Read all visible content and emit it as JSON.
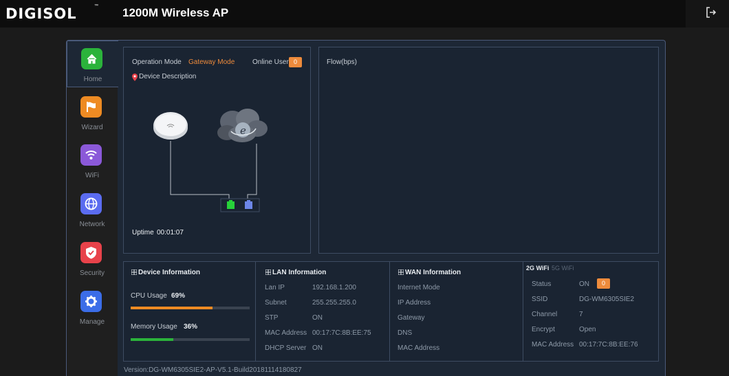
{
  "header": {
    "logo": "DIGISOL",
    "logo_tm": "™",
    "title": "1200M Wireless AP"
  },
  "sidebar": {
    "items": [
      {
        "label": "Home",
        "icon": "home-icon",
        "color": "#2bb33b",
        "active": true
      },
      {
        "label": "Wizard",
        "icon": "flag-icon",
        "color": "#ee8b23"
      },
      {
        "label": "WiFi",
        "icon": "wifi-icon",
        "color": "#8b59d9"
      },
      {
        "label": "Network",
        "icon": "globe-icon",
        "color": "#5b6cf0"
      },
      {
        "label": "Security",
        "icon": "shield-icon",
        "color": "#e8424a"
      },
      {
        "label": "Manage",
        "icon": "gear-icon",
        "color": "#3b6de8"
      }
    ]
  },
  "status": {
    "operation_mode_label": "Operation Mode",
    "operation_mode_value": "Gateway Mode",
    "online_user_label": "Online User",
    "online_user_count": "0",
    "device_description": "Device Description",
    "uptime_label": "Uptime",
    "uptime_value": "00:01:07"
  },
  "flow": {
    "label": "Flow(bps)"
  },
  "device_info": {
    "title": "Device Information",
    "cpu_label": "CPU Usage",
    "cpu_value": "69%",
    "cpu_fraction": 0.69,
    "memory_label": "Memory Usage",
    "memory_value": "36%",
    "memory_fraction": 0.36,
    "cpu_color": "#ee8b23",
    "memory_color": "#2bb33b"
  },
  "lan_info": {
    "title": "LAN Information",
    "rows": [
      {
        "label": "Lan IP",
        "value": "192.168.1.200"
      },
      {
        "label": "Subnet",
        "value": "255.255.255.0"
      },
      {
        "label": "STP",
        "value": "ON"
      },
      {
        "label": "MAC Address",
        "value": "00:17:7C:8B:EE:75"
      },
      {
        "label": "DHCP Server",
        "value": "ON"
      }
    ]
  },
  "wan_info": {
    "title": "WAN Information",
    "rows": [
      {
        "label": "Internet Mode"
      },
      {
        "label": "IP Address"
      },
      {
        "label": "Gateway"
      },
      {
        "label": "DNS"
      },
      {
        "label": "MAC Address"
      }
    ]
  },
  "wifi_info": {
    "tab_2g": "2G WiFi",
    "tab_5g": "5G WiFi",
    "status_label": "Status",
    "status_value": "ON",
    "status_count": "0",
    "ssid_label": "SSID",
    "ssid_value": "DG-WM6305SIE2",
    "channel_label": "Channel",
    "channel_value": "7",
    "encrypt_label": "Encrypt",
    "encrypt_value": "Open",
    "mac_label": "MAC Address",
    "mac_value": "00:17:7C:8B:EE:76"
  },
  "footer": {
    "version": "Version:DG-WM6305SIE2-AP-V5.1-Build20181114180827"
  }
}
